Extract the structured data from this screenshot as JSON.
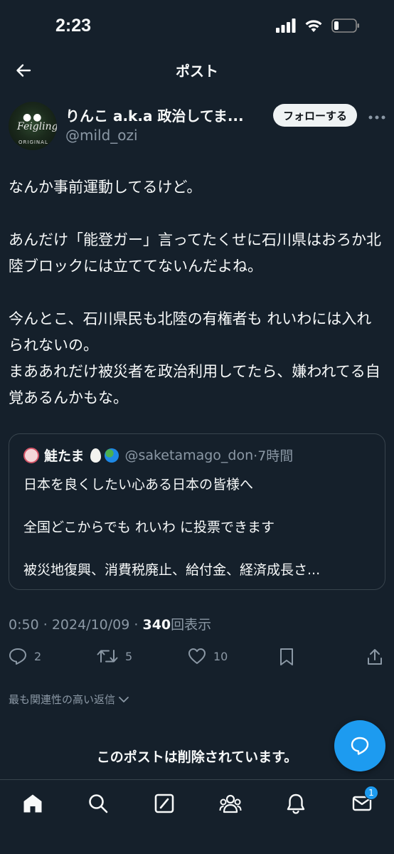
{
  "status_bar": {
    "time": "2:23"
  },
  "header": {
    "title": "ポスト"
  },
  "author": {
    "name": "りんこ a.k.a 政治してま...",
    "handle": "@mild_ozi",
    "follow_label": "フォローする"
  },
  "post": {
    "paragraphs": [
      "なんか事前運動してるけど。",
      "あんだけ「能登ガー」言ってたくせに石川県はおろか北陸ブロックには立ててないんだよね。",
      "今んとこ、石川県民も北陸の有権者も れいわには入れられないの。\nまああれだけ被災者を政治利用してたら、嫌われてる自覚あるんかもな。"
    ]
  },
  "quote": {
    "name": "鮭たま",
    "handle": "@saketamago_don",
    "time": "·7時間",
    "lines": [
      "日本を良くしたい心ある日本の皆様へ",
      "全国どこからでも れいわ に投票できます",
      "被災地復興、消費税廃止、給付金、経済成長さ..."
    ]
  },
  "meta": {
    "time": "0:50",
    "date": "2024/10/09",
    "separator": "·",
    "views": "340",
    "views_label": "回表示"
  },
  "actions": {
    "replies": "2",
    "reposts": "5",
    "likes": "10"
  },
  "replies_filter": {
    "label": "最も関連性の高い返信"
  },
  "deleted_notice": "このポストは削除されています。",
  "tabbar": {
    "messages_badge": "1"
  },
  "icons": [
    "back-arrow-icon",
    "more-icon",
    "reply-icon",
    "repost-icon",
    "like-icon",
    "bookmark-icon",
    "share-icon",
    "chevron-down-icon",
    "compose-reply-icon",
    "home-icon",
    "search-icon",
    "grok-icon",
    "communities-icon",
    "notifications-icon",
    "messages-icon"
  ],
  "colors": {
    "background": "#15202b",
    "accent": "#1d9bf0",
    "secondary_text": "#8b98a5",
    "border": "#38444d"
  }
}
